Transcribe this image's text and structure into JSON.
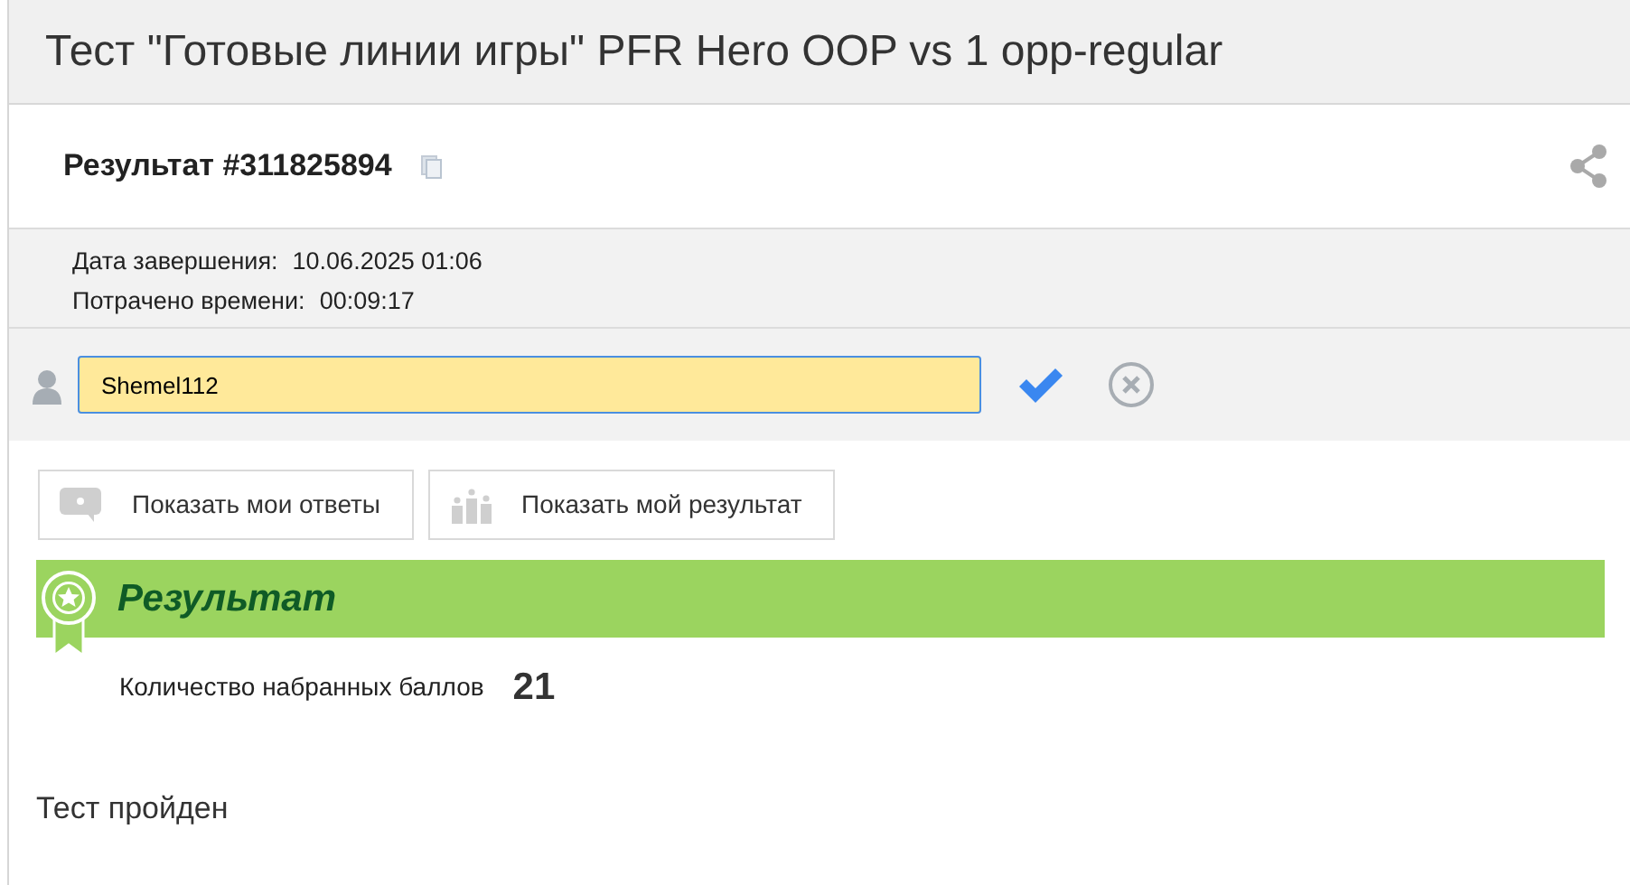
{
  "page_title": "Тест \"Готовые линии игры\" PFR Hero OOP vs 1 opp-regular",
  "result_heading": "Результат #311825894",
  "info": [
    {
      "label": "Дата завершения:",
      "value": "10.06.2025 01:06"
    },
    {
      "label": "Потрачено времени:",
      "value": "00:09:17"
    }
  ],
  "name_field": {
    "value": "Shemel112"
  },
  "buttons": [
    {
      "kind": "answers",
      "label": "Показать мои ответы"
    },
    {
      "kind": "result",
      "label": "Показать мой результат"
    }
  ],
  "result_banner": {
    "title": "Результат"
  },
  "score": {
    "label": "Количество набранных баллов",
    "value": "21"
  },
  "status_text": "Тест пройден"
}
